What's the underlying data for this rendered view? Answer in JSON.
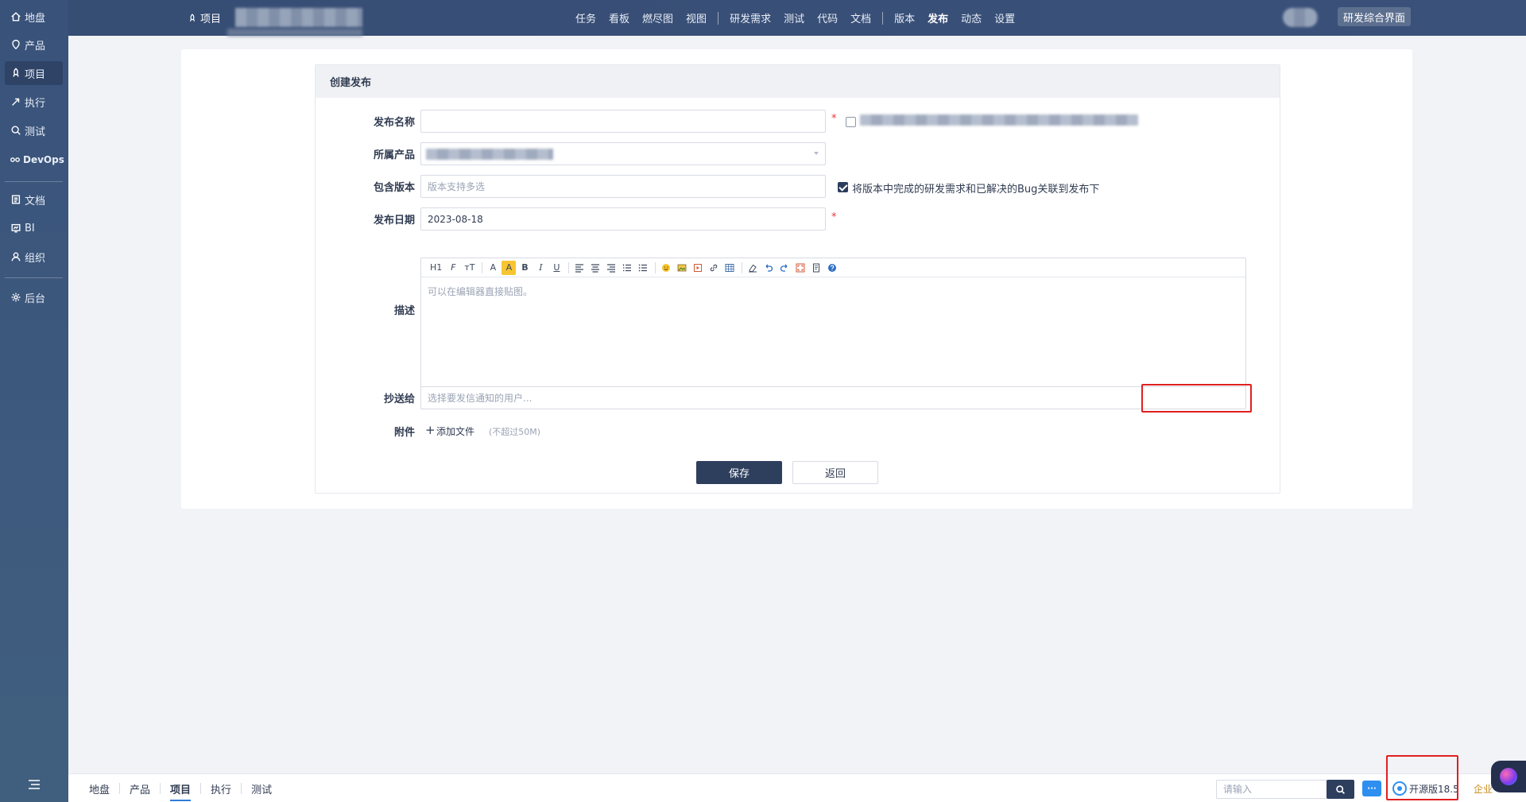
{
  "sidebar": {
    "items": [
      {
        "label": "地盘",
        "icon": "home-icon"
      },
      {
        "label": "产品",
        "icon": "product-icon"
      },
      {
        "label": "项目",
        "icon": "project-icon"
      },
      {
        "label": "执行",
        "icon": "execution-icon"
      },
      {
        "label": "测试",
        "icon": "test-icon"
      },
      {
        "label": "DevOps",
        "icon": "devops-icon"
      },
      {
        "label": "文档",
        "icon": "doc-icon"
      },
      {
        "label": "BI",
        "icon": "bi-icon"
      },
      {
        "label": "组织",
        "icon": "org-icon"
      },
      {
        "label": "后台",
        "icon": "admin-icon"
      }
    ],
    "active_index": 2
  },
  "header": {
    "project_label": "项目",
    "nav": [
      "任务",
      "看板",
      "燃尽图",
      "视图",
      "研发需求",
      "测试",
      "代码",
      "文档",
      "版本",
      "发布",
      "动态",
      "设置"
    ],
    "active_nav": "发布",
    "view_switch": "研发综合界面"
  },
  "form": {
    "title": "创建发布",
    "name_label": "发布名称",
    "product_label": "所属产品",
    "build_label": "包含版本",
    "build_placeholder": "版本支持多选",
    "sync_text": "将版本中完成的研发需求和已解决的Bug关联到发布下",
    "date_label": "发布日期",
    "date_value": "2023-08-18",
    "desc_label": "描述",
    "desc_placeholder": "可以在编辑器直接贴图。",
    "mailto_label": "抄送给",
    "mailto_placeholder": "选择要发信通知的用户...",
    "files_label": "附件",
    "add_file": "添加文件",
    "file_limit": "(不超过50M)",
    "save": "保存",
    "back": "返回",
    "required_mark": "*"
  },
  "editor_toolbar": [
    "H1",
    "F",
    "тT",
    "A",
    "A",
    "B",
    "I",
    "U"
  ],
  "bottombar": {
    "breadcrumb": [
      "地盘",
      "产品",
      "项目",
      "执行",
      "测试"
    ],
    "active_crumb": "项目",
    "search_placeholder": "请输入",
    "version": "开源版18.5",
    "enterprise": "企业"
  },
  "colors": {
    "sidebar": "#3a537a",
    "header": "#364d74",
    "primary_button": "#2e3f5e",
    "required": "#e43b3b",
    "annotation": "#e02020"
  }
}
